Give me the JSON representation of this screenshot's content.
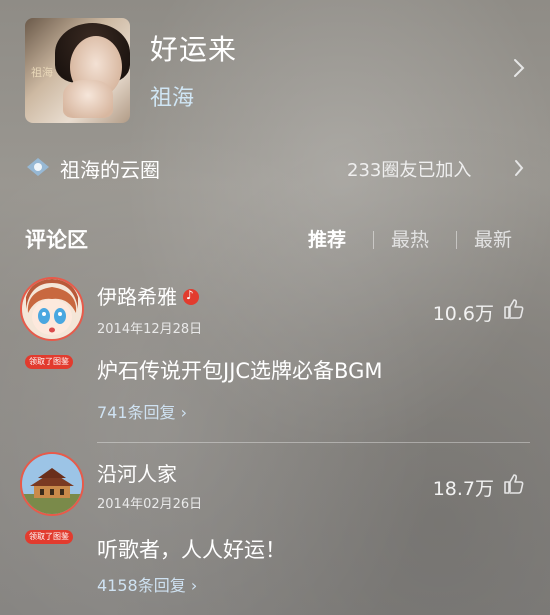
{
  "song": {
    "title": "好运来",
    "artist": "祖海",
    "cover_logo": "祖海"
  },
  "cloud": {
    "title": "祖海的云圈",
    "members": "233圈友已加入"
  },
  "comments_section": {
    "title": "评论区",
    "tabs": [
      {
        "label": "推荐",
        "active": true
      },
      {
        "label": "最热",
        "active": false
      },
      {
        "label": "最新",
        "active": false
      }
    ]
  },
  "comments": [
    {
      "username": "伊路希雅",
      "date": "2014年12月28日",
      "likes": "10.6万",
      "text": "炉石传说开包JJC选牌必备BGM",
      "replies": "741条回复",
      "avatar_badge": "领取了图鉴",
      "has_music_badge": true
    },
    {
      "username": "沿河人家",
      "date": "2014年02月26日",
      "likes": "18.7万",
      "text": "听歌者，人人好运！",
      "replies": "4158条回复",
      "avatar_badge": "领取了图鉴",
      "has_music_badge": false
    }
  ],
  "colors": {
    "link": "#cfe2f2",
    "badge": "#e23b2e"
  }
}
